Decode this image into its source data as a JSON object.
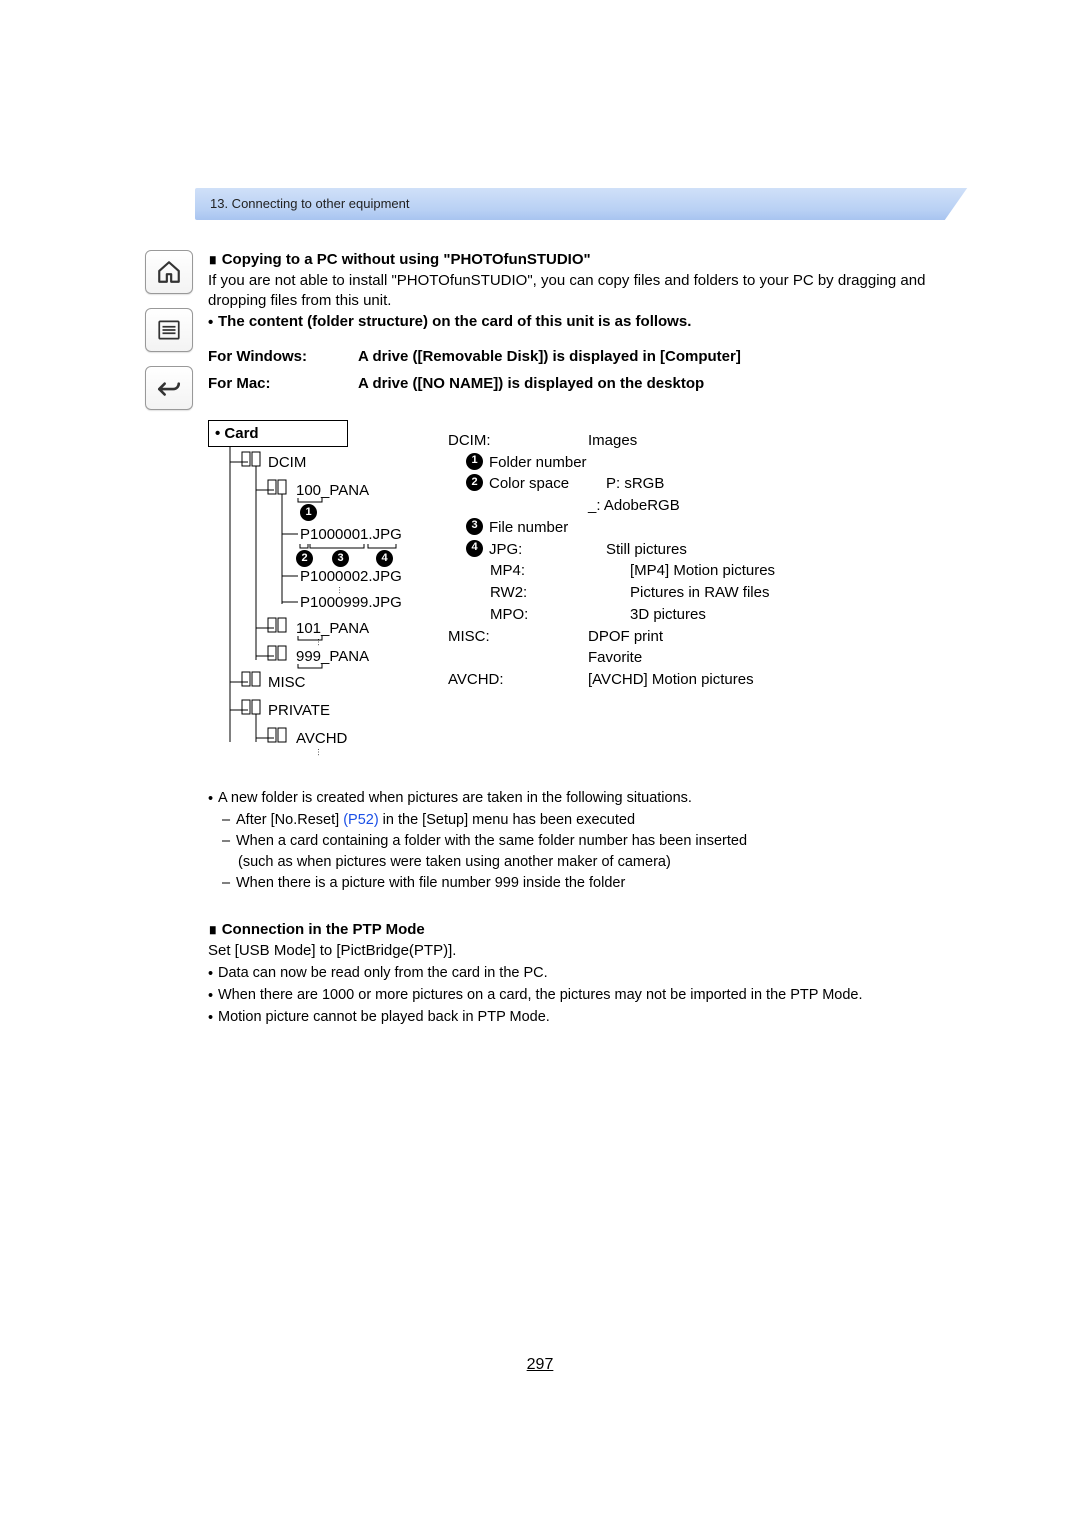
{
  "chapter": "13. Connecting to other equipment",
  "sec1": {
    "title": "∎ Copying to a PC without using \"PHOTOfunSTUDIO\"",
    "body": "If you are not able to install \"PHOTOfunSTUDIO\", you can copy files and folders to your PC by dragging and dropping files from this unit.",
    "structure_note": "The content (folder structure) on the card of this unit is as follows.",
    "os": {
      "win_k": "For Windows:",
      "win_v": "A drive ([Removable Disk]) is displayed in [Computer]",
      "mac_k": "For Mac:",
      "mac_v": "A drive ([NO NAME]) is displayed on the desktop"
    }
  },
  "tree": {
    "card": "• Card",
    "dcim": "DCIM",
    "f100": "100_PANA",
    "p1": "P1000001.JPG",
    "p2": "P1000002.JPG",
    "p999": "P1000999.JPG",
    "f101": "101_PANA",
    "f999": "999_PANA",
    "misc": "MISC",
    "private": "PRIVATE",
    "avchd": "AVCHD"
  },
  "legend": {
    "dcim_k": "DCIM:",
    "dcim_v": "Images",
    "n1": "Folder number",
    "n2": "Color space",
    "n2_v": "P: sRGB",
    "n2_v2": "_: AdobeRGB",
    "n3": "File number",
    "n4": "JPG:",
    "n4_v": "Still pictures",
    "mp4_k": "MP4:",
    "mp4_v": "[MP4] Motion pictures",
    "rw2_k": "RW2:",
    "rw2_v": "Pictures in RAW files",
    "mpo_k": "MPO:",
    "mpo_v": "3D pictures",
    "misc_k": "MISC:",
    "misc_v": "DPOF print",
    "misc_v2": "Favorite",
    "avchd_k": "AVCHD:",
    "avchd_v": "[AVCHD] Motion pictures"
  },
  "notes": {
    "b1": "A new folder is created when pictures are taken in the following situations.",
    "d1a": "After [No.Reset] ",
    "d1link": "(P52)",
    "d1b": " in the [Setup] menu has been executed",
    "d2": "When a card containing a folder with the same folder number has been inserted",
    "d2b": "(such as when pictures were taken using another maker of camera)",
    "d3": "When there is a picture with file number 999 inside the folder"
  },
  "sec2": {
    "title": "∎ Connection in the PTP Mode",
    "body": "Set [USB Mode] to [PictBridge(PTP)].",
    "b1": "Data can now be read only from the card in the PC.",
    "b2": "When there are 1000 or more pictures on a card, the pictures may not be imported in the PTP Mode.",
    "b3": "Motion picture cannot be played back in PTP Mode."
  },
  "page": "297"
}
